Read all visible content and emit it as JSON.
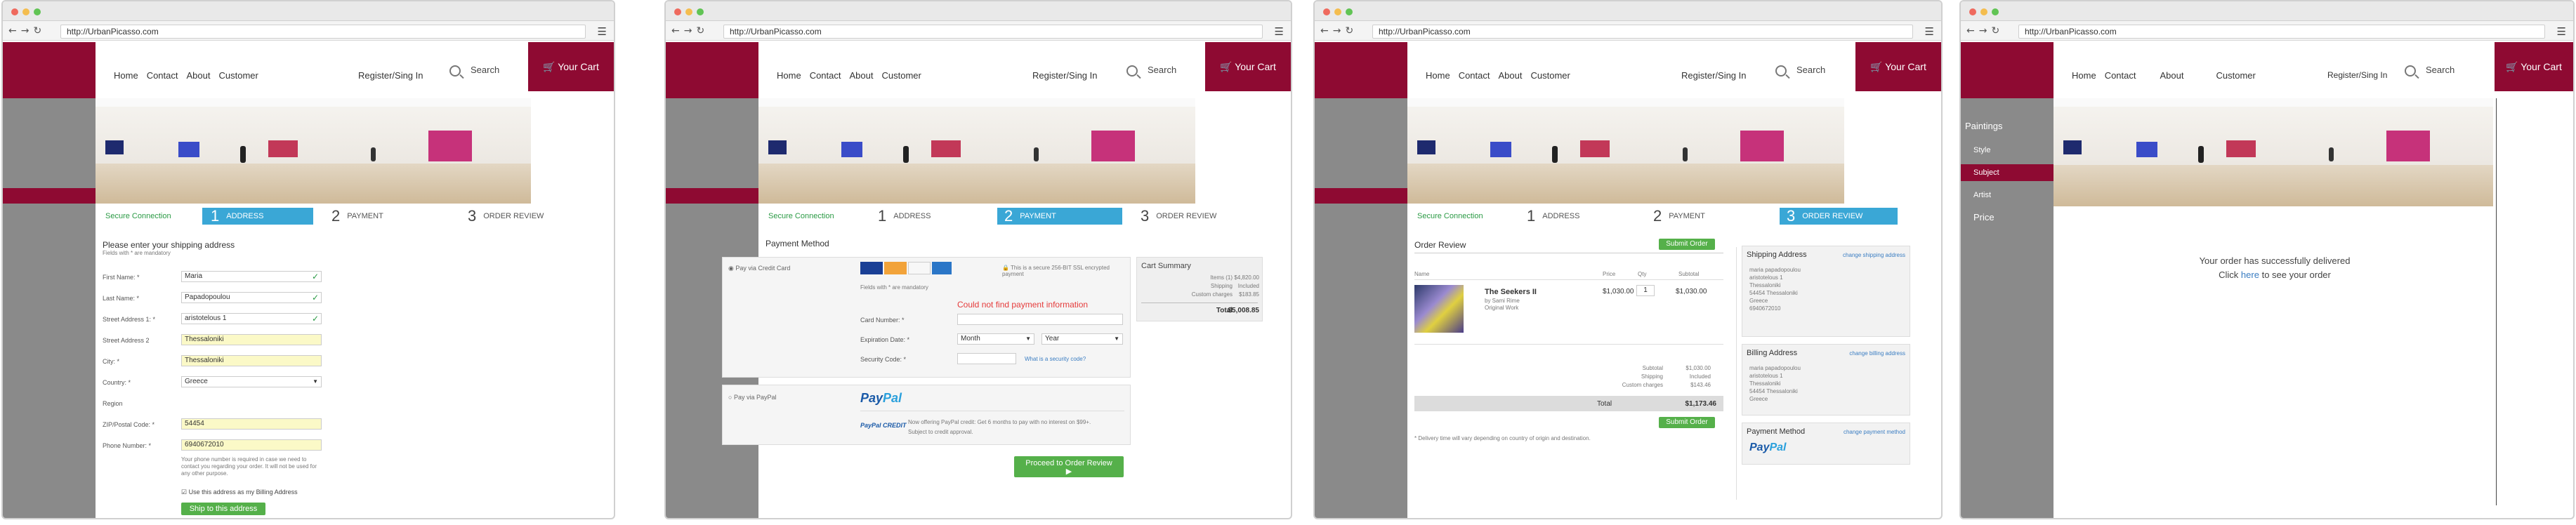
{
  "browser": {
    "url": "http://UrbanPicasso.com"
  },
  "site": {
    "nav": [
      "Home",
      "Contact",
      "About",
      "Customer"
    ],
    "register": "Register/Sing In",
    "search": "Search",
    "cart": "Your Cart"
  },
  "steps": {
    "secure": "Secure Connection",
    "s1num": "1",
    "s1": "ADDRESS",
    "s2num": "2",
    "s2": "PAYMENT",
    "s3num": "3",
    "s3": "ORDER REVIEW"
  },
  "shipping": {
    "title": "Please enter your shipping address",
    "subtitle": "Fields with * are mandatory",
    "fields": [
      {
        "label": "First Name: *",
        "value": "Maria"
      },
      {
        "label": "Last Name: *",
        "value": "Papadopoulou"
      },
      {
        "label": "Street Address 1: *",
        "value": "aristotelous 1"
      },
      {
        "label": "Street Address 2",
        "value": "Thessaloniki"
      },
      {
        "label": "City: *",
        "value": "Thessaloniki"
      },
      {
        "label": "Country: *",
        "value": "Greece"
      },
      {
        "label": "Region",
        "value": ""
      },
      {
        "label": "ZIP/Postal Code: *",
        "value": "54454"
      },
      {
        "label": "Phone Number: *",
        "value": "6940672010"
      }
    ],
    "phone_note": "Your phone number is required in case we need to contact you regarding your order. It will not be used for any other purpose.",
    "billing_check": "Use this address as my Billing Address",
    "ship_button": "Ship to this address"
  },
  "payment": {
    "title": "Payment Method",
    "credit_label": "Pay via Credit Card",
    "secure_note": "This is a secure 256-BIT SSL encrypted payment",
    "fields_note": "Fields with * are mandatory",
    "error": "Could not find payment information",
    "card_number": "Card Number: *",
    "expiration": "Expiration Date: *",
    "month": "Month",
    "year": "Year",
    "security": "Security Code: *",
    "what_security": "What is a security code?",
    "paypal_label": "Pay via PayPal",
    "paypal_logo_a": "Pay",
    "paypal_logo_b": "Pal",
    "credit_logo": "PayPal CREDIT",
    "credit_text": "Now offering PayPal credit: Get 6 months to pay with no interest on $99+.",
    "credit_sub": "Subject to credit approval.",
    "proceed": "Proceed to Order Review"
  },
  "cart_summary": {
    "title": "Cart Summary",
    "rows": [
      {
        "label": "Items (1)",
        "value": "$4,820.00"
      },
      {
        "label": "Shipping",
        "value": "Included"
      },
      {
        "label": "Custom charges",
        "value": "$183.85"
      }
    ],
    "total_label": "Total",
    "total_value": "$5,008.85"
  },
  "review": {
    "title": "Order Review",
    "submit": "Submit Order",
    "cols": [
      "Name",
      "Price",
      "Qty",
      "Subtotal"
    ],
    "item_title": "The Seekers II",
    "item_by": "by Sami Rime",
    "item_type": "Original Work",
    "item_price": "$1,030.00",
    "item_qty": "1",
    "item_subtotal": "$1,030.00",
    "subtotal_label": "Subtotal",
    "subtotal_value": "$1,030.00",
    "shipping_label": "Shipping",
    "shipping_value": "Included",
    "custom_label": "Custom charges",
    "custom_value": "$143.46",
    "total_label": "Total",
    "total_value": "$1,173.46",
    "note": "* Delivery time will vary depending on country of origin and destination.",
    "ship_title": "Shipping Address",
    "ship_change": "change shipping address",
    "bill_title": "Billing Address",
    "bill_change": "change billing address",
    "addr": [
      "maria papadopoulou",
      "aristotelous 1",
      "Thessaloniki",
      "54454 Thessaloniki",
      "Greece",
      "6940672010"
    ],
    "pay_title": "Payment Method",
    "pay_change": "change payment method"
  },
  "done": {
    "categories": [
      "Paintings",
      "Style",
      "Subject",
      "Artist",
      "Price"
    ],
    "message": "Your order has successfully delivered",
    "click": "Click",
    "here": "here",
    "see": "to see your order"
  },
  "colors": {
    "brand": "#8e0a32",
    "accent": "#3aa7d6",
    "green": "#55b04a"
  }
}
